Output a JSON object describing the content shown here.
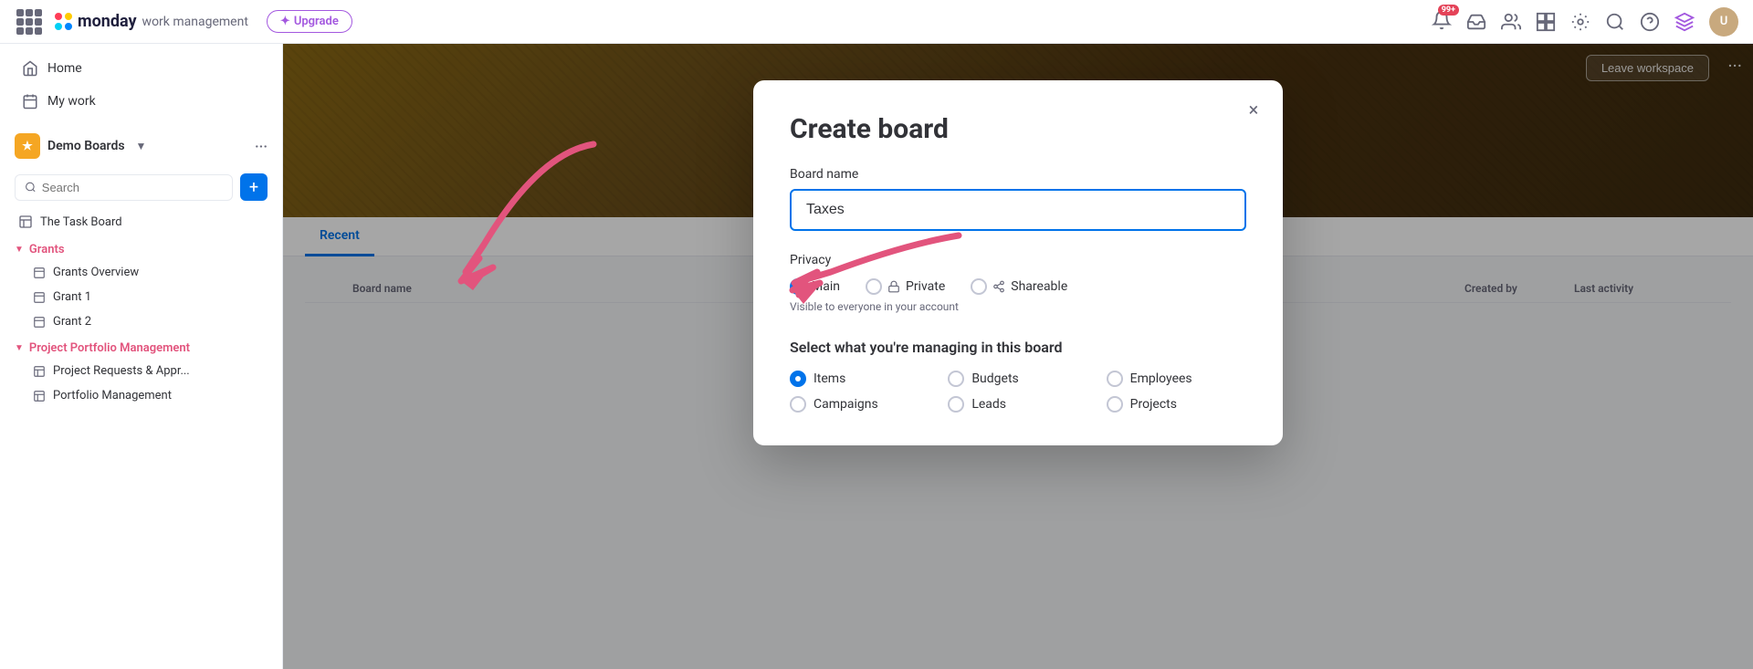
{
  "topnav": {
    "app_name": "monday",
    "app_sub": "work management",
    "upgrade_label": "Upgrade",
    "notification_count": "99+",
    "avatar_initials": "U"
  },
  "sidebar": {
    "nav_items": [
      {
        "id": "home",
        "label": "Home",
        "icon": "home"
      },
      {
        "id": "my-work",
        "label": "My work",
        "icon": "check-square"
      }
    ],
    "workspace": {
      "name": "Demo Boards",
      "icon": "★"
    },
    "search_placeholder": "Search",
    "add_button": "+",
    "items": [
      {
        "id": "task-board",
        "label": "The Task Board"
      }
    ],
    "sections": [
      {
        "id": "grants",
        "label": "Grants",
        "expanded": true,
        "children": [
          {
            "id": "grants-overview",
            "label": "Grants Overview"
          },
          {
            "id": "grant-1",
            "label": "Grant 1"
          },
          {
            "id": "grant-2",
            "label": "Grant 2"
          }
        ]
      },
      {
        "id": "project-portfolio",
        "label": "Project Portfolio Management",
        "expanded": true,
        "children": [
          {
            "id": "project-requests",
            "label": "Project Requests & Appr..."
          },
          {
            "id": "portfolio-mgmt",
            "label": "Portfolio Management"
          }
        ]
      }
    ]
  },
  "board_header": {
    "leave_workspace_label": "Leave workspace"
  },
  "tabs": [
    {
      "id": "recent",
      "label": "Recent",
      "active": true
    }
  ],
  "table": {
    "columns": [
      "",
      "Board name",
      "Created by",
      "Last activity",
      ""
    ],
    "rows": []
  },
  "modal": {
    "title": "Create board",
    "close_icon": "×",
    "board_name_label": "Board name",
    "board_name_value": "Taxes",
    "privacy_label": "Privacy",
    "privacy_options": [
      {
        "id": "main",
        "label": "Main",
        "selected": true,
        "icon": null
      },
      {
        "id": "private",
        "label": "Private",
        "selected": false,
        "icon": "🔒"
      },
      {
        "id": "shareable",
        "label": "Shareable",
        "selected": false,
        "icon": "⊕"
      }
    ],
    "privacy_desc": "Visible to everyone in your account",
    "manage_label": "Select what you're managing in this board",
    "manage_options": [
      {
        "id": "items",
        "label": "Items",
        "selected": true
      },
      {
        "id": "budgets",
        "label": "Budgets",
        "selected": false
      },
      {
        "id": "employees",
        "label": "Employees",
        "selected": false
      },
      {
        "id": "campaigns",
        "label": "Campaigns",
        "selected": false
      },
      {
        "id": "leads",
        "label": "Leads",
        "selected": false
      },
      {
        "id": "projects",
        "label": "Projects",
        "selected": false
      }
    ]
  },
  "pink_arrow": {
    "visible": true
  }
}
